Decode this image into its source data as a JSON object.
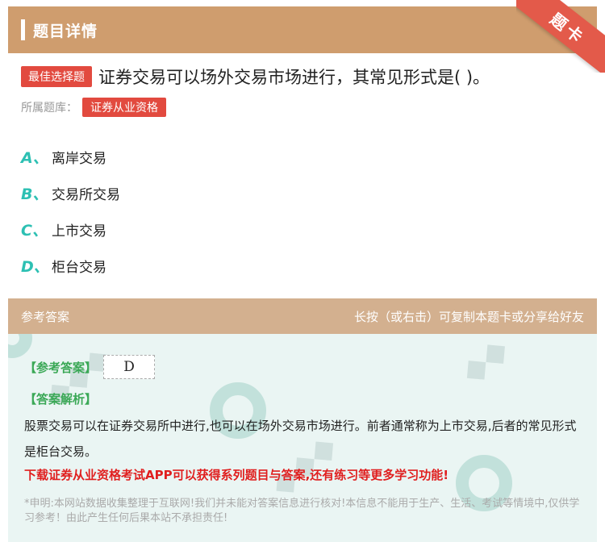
{
  "header": {
    "title": "题目详情"
  },
  "ribbon": {
    "label": "题卡"
  },
  "question": {
    "type_tag": "最佳选择题",
    "text": "证券交易可以场外交易市场进行，其常见形式是( )。",
    "bank_label": "所属题库：",
    "bank_tag": "证券从业资格"
  },
  "options": [
    {
      "letter": "A、",
      "text": "离岸交易"
    },
    {
      "letter": "B、",
      "text": "交易所交易"
    },
    {
      "letter": "C、",
      "text": "上市交易"
    },
    {
      "letter": "D、",
      "text": "柜台交易"
    }
  ],
  "answer_card": {
    "title": "参考答案",
    "hint": "长按（或右击）可复制本题卡或分享给好友",
    "ref_label": "【参考答案】",
    "ref_value": "D",
    "analysis_label": "【答案解析】",
    "analysis_text": "股票交易可以在证券交易所中进行,也可以在场外交易市场进行。前者通常称为上市交易,后者的常见形式是柜台交易。",
    "promo": "下载证券从业资格考试APP可以获得系列题目与答案,还有练习等更多学习功能!",
    "disclaimer": "*申明:本网站数据收集整理于互联网!我们并未能对答案信息进行核对!本信息不能用于生产、生活、考试等情境中,仅供学习参考！由此产生任何后果本站不承担责任!"
  }
}
